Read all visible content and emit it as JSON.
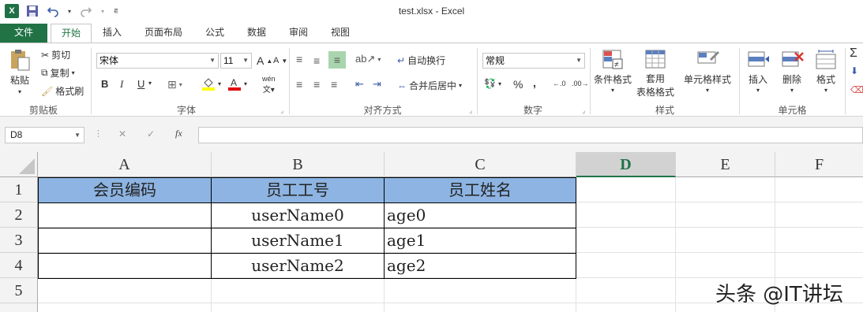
{
  "window": {
    "title": "test.xlsx - Excel"
  },
  "qat": {
    "logo": "X",
    "save_icon": "save-icon",
    "undo_icon": "undo-icon",
    "redo_icon": "redo-icon"
  },
  "tabs": [
    {
      "label": "文件"
    },
    {
      "label": "开始"
    },
    {
      "label": "插入"
    },
    {
      "label": "页面布局"
    },
    {
      "label": "公式"
    },
    {
      "label": "数据"
    },
    {
      "label": "审阅"
    },
    {
      "label": "视图"
    }
  ],
  "ribbon": {
    "clipboard": {
      "paste": "粘贴",
      "cut": "剪切",
      "copy": "复制",
      "format_painter": "格式刷",
      "label": "剪贴板"
    },
    "font": {
      "name": "宋体",
      "size": "11",
      "label": "字体",
      "bold": "B",
      "italic": "I",
      "underline": "U",
      "grow": "A",
      "shrink": "A",
      "phonetic": "wén"
    },
    "alignment": {
      "wrap": "自动换行",
      "merge": "合并后居中",
      "label": "对齐方式"
    },
    "number": {
      "format": "常规",
      "percent": "%",
      "comma": ",",
      "label": "数字"
    },
    "styles": {
      "conditional": "条件格式",
      "table_line1": "套用",
      "table_line2": "表格格式",
      "cell_styles": "单元格样式",
      "label": "样式"
    },
    "cells": {
      "insert": "插入",
      "delete": "删除",
      "format": "格式",
      "label": "单元格"
    }
  },
  "formula_bar": {
    "name_box": "D8",
    "cancel": "✕",
    "enter": "✓",
    "fx": "fx",
    "value": ""
  },
  "columns": [
    "A",
    "B",
    "C",
    "D",
    "E",
    "F"
  ],
  "rows": [
    "1",
    "2",
    "3",
    "4",
    "5"
  ],
  "sheet": {
    "header": [
      "会员编码",
      "员工工号",
      "员工姓名"
    ],
    "data": [
      [
        "",
        "userName0",
        "age0"
      ],
      [
        "",
        "userName1",
        "age1"
      ],
      [
        "",
        "userName2",
        "age2"
      ]
    ]
  },
  "colors": {
    "excel_green": "#217346",
    "header_fill": "#8db4e2"
  },
  "watermark": "头条 @IT讲坛"
}
